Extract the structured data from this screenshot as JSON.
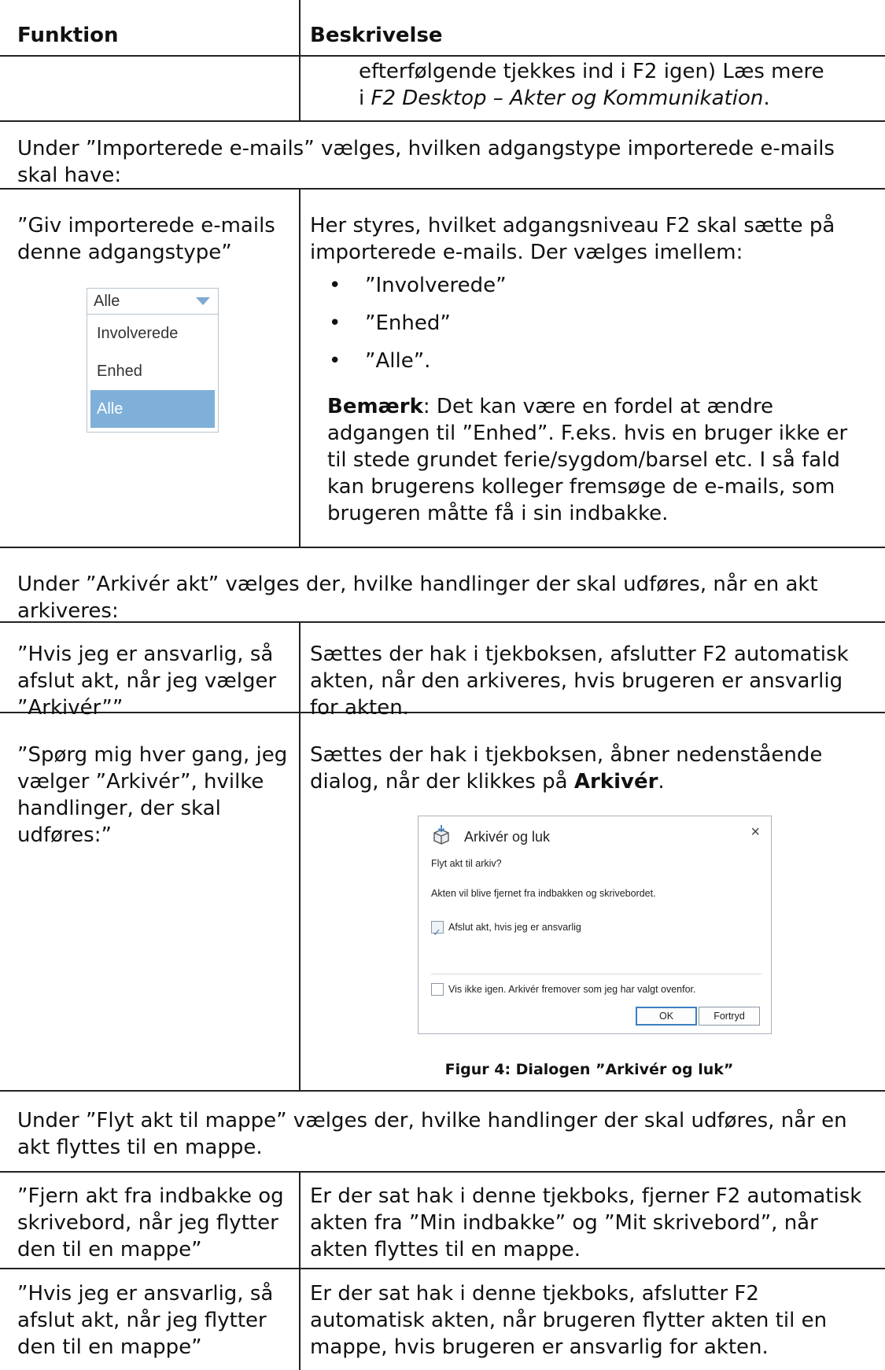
{
  "header": {
    "col1": "Funktion",
    "col2": "Beskrivelse"
  },
  "row0": {
    "desc_part1": "efterfølgende tjekkes ind i F2 igen) Læs mere",
    "desc_part2_prefix": "i ",
    "desc_part2_italic": "F2 Desktop – Akter og Kommunikation",
    "desc_part2_suffix": "."
  },
  "section_imported": {
    "text": "Under ”Importerede e-mails” vælges, hvilken adgangstype importerede e-mails skal have:"
  },
  "row_access": {
    "funktion": "”Giv importerede e-mails denne adgangstype”",
    "dropdown": {
      "selected": "Alle",
      "options": [
        "Involverede",
        "Enhed",
        "Alle"
      ],
      "highlight_color": "#7fb0d9"
    },
    "desc_intro": "Her styres, hvilket adgangsniveau F2 skal sætte på importerede e-mails. Der vælges imellem:",
    "bullets": [
      "”Involverede”",
      "”Enhed”",
      "”Alle”."
    ],
    "note_bold": "Bemærk",
    "note_text": ": Det kan være en fordel at ændre adgangen til ”Enhed”. F.eks. hvis en bruger ikke er til stede grundet ferie/sygdom/barsel etc. I så fald kan brugerens kolleger fremsøge de e-mails, som brugeren måtte få i sin indbakke."
  },
  "section_archive": {
    "text": "Under ”Arkivér akt” vælges der, hvilke handlinger der skal udføres, når en akt arkiveres:"
  },
  "row_archive1": {
    "funktion": "”Hvis jeg er ansvarlig, så afslut akt, når jeg vælger ”Arkivér””",
    "desc": "Sættes der hak i tjekboksen, afslutter F2 automatisk akten, når den arkiveres, hvis brugeren er ansvarlig for akten."
  },
  "row_archive2": {
    "funktion": "”Spørg mig hver gang, jeg vælger ”Arkivér”, hvilke handlinger, der skal udføres:”",
    "desc_prefix": "Sættes der hak i tjekboksen, åbner nedenstående dialog, når der klikkes på ",
    "desc_bold": "Arkivér",
    "desc_suffix": ".",
    "dialog": {
      "title": "Arkivér og luk",
      "close_glyph": "×",
      "question": "Flyt akt til arkiv?",
      "info": "Akten vil blive fjernet fra indbakken og skrivebordet.",
      "checkbox1_label": "Afslut akt, hvis jeg er ansvarlig",
      "checkbox1_checked": true,
      "checkbox2_label": "Vis ikke igen. Arkivér fremover som jeg har valgt ovenfor.",
      "checkbox2_checked": false,
      "ok_label": "OK",
      "cancel_label": "Fortryd"
    },
    "caption": "Figur 4: Dialogen ”Arkivér og luk”"
  },
  "section_move": {
    "text": "Under ”Flyt akt til mappe” vælges der, hvilke handlinger der skal udføres, når en akt flyttes til en mappe."
  },
  "row_move1": {
    "funktion": "”Fjern akt fra indbakke og skrivebord, når jeg flytter den til en mappe”",
    "desc": "Er der sat hak i denne tjekboks, fjerner F2 automatisk akten fra ”Min indbakke” og ”Mit skrivebord”, når akten flyttes til en mappe."
  },
  "row_move2": {
    "funktion": "”Hvis jeg er ansvarlig, så afslut akt, når jeg flytter den til en mappe”",
    "desc": "Er der sat hak i denne tjekboks, afslutter F2 automatisk akten, når brugeren flytter akten til en mappe, hvis brugeren er ansvarlig for akten."
  }
}
